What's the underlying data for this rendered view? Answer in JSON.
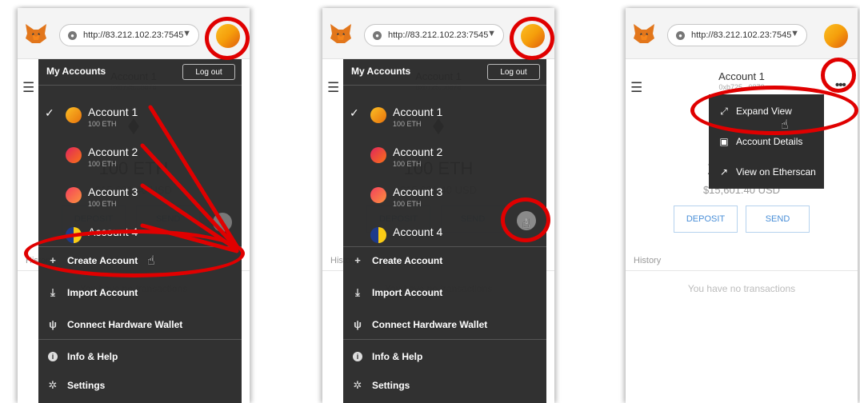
{
  "url": "http://83.212.102.23:7545",
  "account_page": {
    "title": "Account 1",
    "address": "0xb725...0878",
    "balance": "100 ETH",
    "usd": "$15,601.40 USD",
    "deposit_label": "DEPOSIT",
    "send_label": "SEND",
    "history_label": "History",
    "no_tx_label": "You have no transactions"
  },
  "accounts_menu": {
    "title": "My Accounts",
    "logout_label": "Log out",
    "accounts": [
      {
        "name": "Account 1",
        "balance": "100 ETH",
        "selected": true,
        "color_a": "#fbbf24",
        "color_b": "#e8720c"
      },
      {
        "name": "Account 2",
        "balance": "100 ETH",
        "selected": false,
        "color_a": "#e0245e",
        "color_b": "#f97316"
      },
      {
        "name": "Account 3",
        "balance": "100 ETH",
        "selected": false,
        "color_a": "#f43f5e",
        "color_b": "#fb923c"
      },
      {
        "name": "Account 4",
        "balance": "100 ETH",
        "selected": false,
        "color_a": "#facc15",
        "color_b": "#1e3a8a"
      }
    ],
    "actions": [
      {
        "label": "Create Account",
        "icon": "plus-icon"
      },
      {
        "label": "Import Account",
        "icon": "import-icon"
      },
      {
        "label": "Connect Hardware Wallet",
        "icon": "usb-icon"
      }
    ],
    "footer": [
      {
        "label": "Info & Help",
        "icon": "info-icon"
      },
      {
        "label": "Settings",
        "icon": "gear-icon"
      }
    ]
  },
  "options_menu": {
    "items": [
      {
        "label": "Expand View",
        "icon": "expand-icon"
      },
      {
        "label": "Account Details",
        "icon": "details-icon"
      },
      {
        "label": "View on Etherscan",
        "icon": "external-link-icon"
      }
    ]
  },
  "colors": {
    "annotation": "#e00000",
    "menu_background": "#2a2a2a",
    "button_text": "#4a8fd8"
  }
}
